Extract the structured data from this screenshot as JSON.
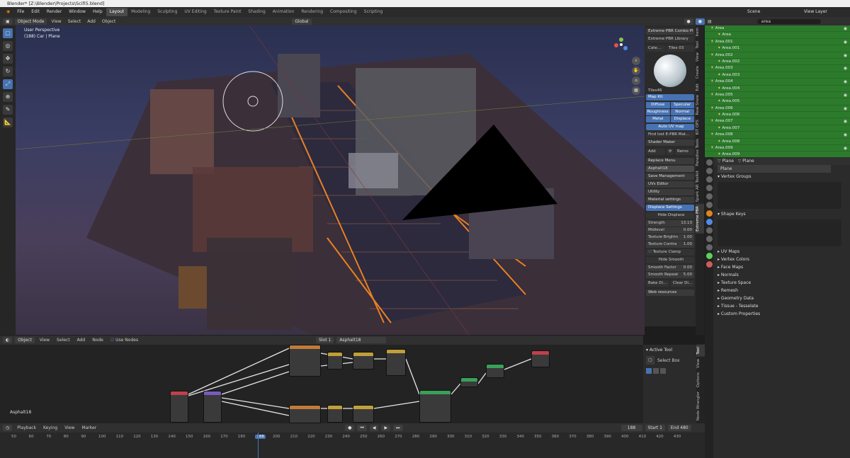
{
  "window": {
    "title": "Blender* [Z:\\Blender\\Projects\\Scifi5.blend]"
  },
  "menu": [
    "File",
    "Edit",
    "Render",
    "Window",
    "Help"
  ],
  "workspaces": [
    "Layout",
    "Modeling",
    "Sculpting",
    "UV Editing",
    "Texture Paint",
    "Shading",
    "Animation",
    "Rendering",
    "Compositing",
    "Scripting"
  ],
  "active_workspace": "Layout",
  "topright": {
    "scene_label": "Scene",
    "viewlayer_label": "View Layer"
  },
  "viewport_header": {
    "mode": "Object Mode",
    "view": "View",
    "select": "Select",
    "add": "Add",
    "object": "Object",
    "orientation": "Global"
  },
  "viewport": {
    "perspective": "User Perspective",
    "selection": "(188) Car | Plane"
  },
  "npanel": {
    "title": "Extreme PBR Combo Pl",
    "library": "Extreme PBR Library",
    "category": "Cate...",
    "tiles": "Tiles 03",
    "material_name": "Tiles46",
    "map_kit": "Map Kit",
    "maps": [
      "Diffuse",
      "Specular",
      "Roughness",
      "Normal",
      "Metal",
      "Displace"
    ],
    "auto_uv": "Auto UV map",
    "find_lost": "Find lost E-PBR Mat...",
    "shader_maker": "Shader Maker",
    "add": "Add",
    "remove": "Remo",
    "replace_menu": "Replace Menu",
    "asphalt": "Asphalt18",
    "save_mgmt": "Save Management",
    "uvs_editor": "UVs Editor",
    "utility": "Utility",
    "material_settings": "Material settings",
    "displace_settings": "Displace Settings",
    "hide_displace": "Hide Displace",
    "params": [
      {
        "k": "Strength",
        "v": "13.13"
      },
      {
        "k": "Midlevel",
        "v": "0.00"
      },
      {
        "k": "Texture Brightn",
        "v": "1.00"
      },
      {
        "k": "Texture Contra",
        "v": "1.00"
      }
    ],
    "texture_clamp": "Texture Clamp",
    "hide_smooth": "Hide Smooth",
    "smooth": [
      {
        "k": "Smooth Factor",
        "v": "0.00"
      },
      {
        "k": "Smooth Repeat",
        "v": "5.00"
      }
    ],
    "bake": "Bake Di...",
    "clear": "Clear Di...",
    "web": "Web resources"
  },
  "npanel_tabs": [
    "Item",
    "Tool",
    "View",
    "Create",
    "Edit",
    "Real Snow",
    "KIT OPS",
    "Paradise Tools",
    "Spark AR Toolkit",
    "Extreme PBR"
  ],
  "outliner": {
    "search": "area",
    "rows": [
      "Area",
      "Area",
      "Area.001",
      "Area.001",
      "Area.002",
      "Area.002",
      "Area.003",
      "Area.003",
      "Area.004",
      "Area.004",
      "Area.005",
      "Area.005",
      "Area.006",
      "Area.006",
      "Area.007",
      "Area.007",
      "Area.008",
      "Area.008",
      "Area.009",
      "Area.009"
    ]
  },
  "properties": {
    "breadcrumb1": "Plane",
    "breadcrumb2": "Plane",
    "mesh_name": "Plane",
    "sections": [
      "Vertex Groups",
      "Shape Keys",
      "UV Maps",
      "Vertex Colors",
      "Face Maps",
      "Normals",
      "Texture Space",
      "Remesh",
      "Geometry Data",
      "Tissue - Tesselate",
      "Custom Properties"
    ]
  },
  "node_header": {
    "object": "Object",
    "view": "View",
    "select": "Select",
    "add": "Add",
    "node": "Node",
    "use_nodes": "Use Nodes",
    "slot": "Slot 1",
    "material": "Asphalt18"
  },
  "node_editor": {
    "material_label": "Asphalt18"
  },
  "active_tool": {
    "title": "Active Tool",
    "name": "Select Box"
  },
  "node_side_tabs": [
    "Tool",
    "View",
    "Options",
    "Node Wrangler"
  ],
  "timeline_header": {
    "playback": "Playback",
    "keying": "Keying",
    "view": "View",
    "marker": "Marker",
    "current": "188",
    "start_label": "Start",
    "start": "1",
    "end_label": "End",
    "end": "480"
  },
  "timeline_frames": [
    "50",
    "60",
    "70",
    "80",
    "90",
    "100",
    "110",
    "120",
    "130",
    "140",
    "150",
    "160",
    "170",
    "180",
    "188",
    "200",
    "210",
    "220",
    "230",
    "240",
    "250",
    "260",
    "270",
    "280",
    "290",
    "300",
    "310",
    "320",
    "330",
    "340",
    "350",
    "360",
    "370",
    "380",
    "390",
    "400",
    "410",
    "420",
    "430"
  ]
}
